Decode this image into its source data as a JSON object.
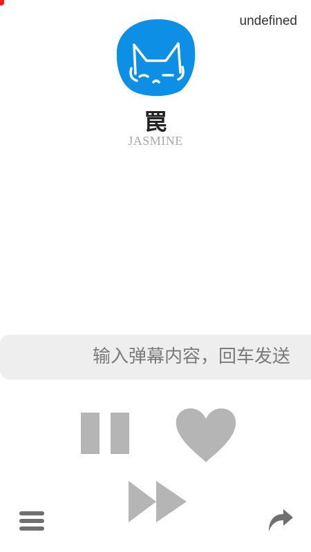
{
  "status": {
    "top_right_text": "undefined"
  },
  "track": {
    "title": "罠",
    "artist": "JASMINE"
  },
  "danmaku": {
    "placeholder": "输入弹幕内容，回车发送"
  },
  "icons": {
    "avatar": "cat-face-avatar",
    "pause": "pause-icon",
    "like": "heart-icon",
    "next": "fast-forward-icon",
    "menu": "hamburger-menu-icon",
    "share": "share-arrow-icon"
  },
  "colors": {
    "avatar_blue": "#0d8fe6",
    "control_gray": "#b5b5b5",
    "icon_dark_gray": "#6f6f6f",
    "input_bg": "#eeeeee",
    "indicator_red": "#ff1a1a"
  }
}
